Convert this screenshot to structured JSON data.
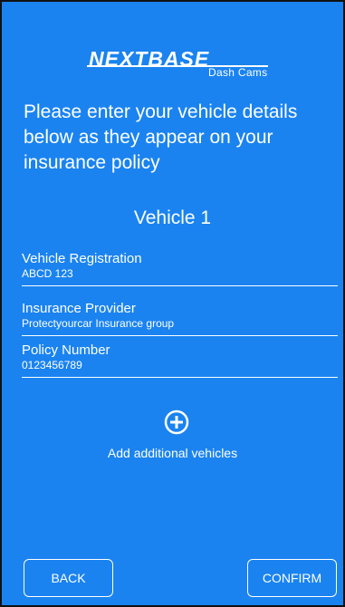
{
  "logo": {
    "brand": "NEXTBASE",
    "subtitle": "Dash Cams"
  },
  "intro_text": "Please enter your vehicle details below as they appear on your insurance policy",
  "vehicle_title": "Vehicle 1",
  "fields": [
    {
      "label": "Vehicle Registration",
      "value": "ABCD 123"
    },
    {
      "label": "Insurance Provider",
      "value": "Protectyourcar Insurance group"
    },
    {
      "label": "Policy Number",
      "value": "0123456789"
    }
  ],
  "add_vehicle": {
    "icon": "plus-circle-icon",
    "label": "Add additional vehicles"
  },
  "buttons": {
    "back": "BACK",
    "confirm": "CONFIRM"
  },
  "colors": {
    "background": "#1A83F0",
    "foreground": "#FFFFFF",
    "frame": "#111111"
  }
}
